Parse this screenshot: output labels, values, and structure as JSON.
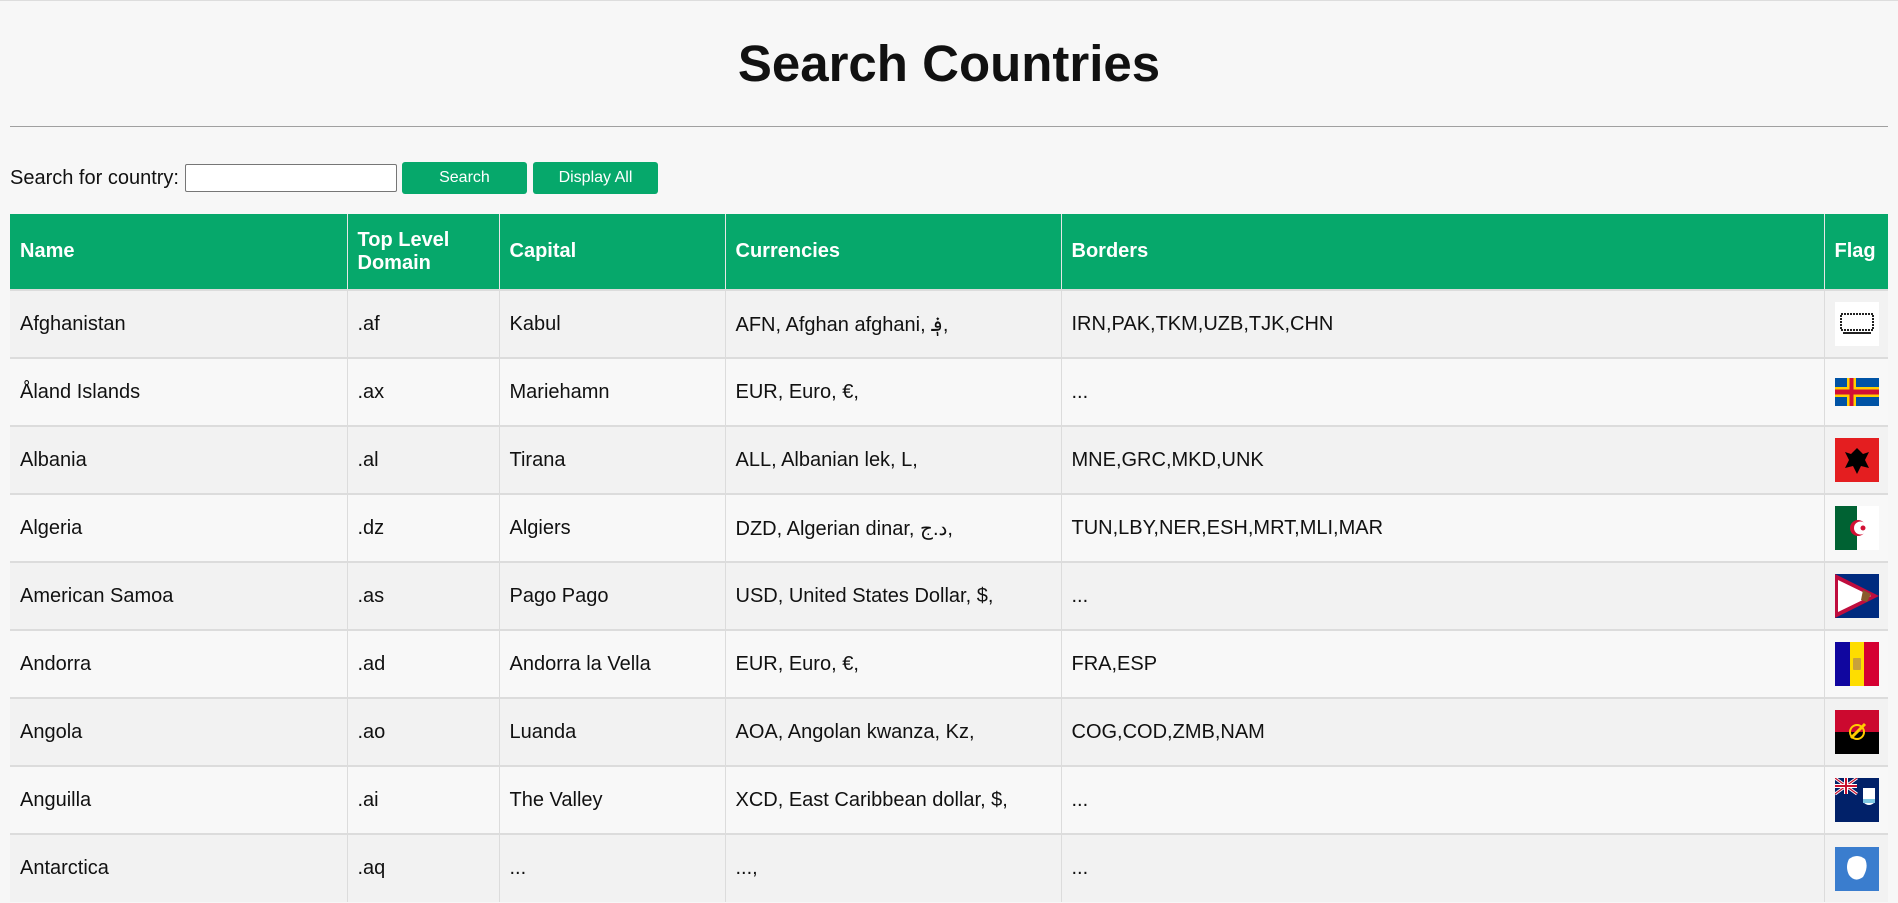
{
  "page": {
    "title": "Search Countries"
  },
  "search": {
    "label": "Search for country:",
    "value": "",
    "placeholder": "",
    "search_button": "Search",
    "display_all_button": "Display All"
  },
  "table": {
    "headers": {
      "name": "Name",
      "tld": "Top Level Domain",
      "capital": "Capital",
      "currencies": "Currencies",
      "borders": "Borders",
      "flag": "Flag"
    },
    "rows": [
      {
        "name": "Afghanistan",
        "tld": ".af",
        "capital": "Kabul",
        "currencies": "AFN, Afghan afghani, ؋,",
        "borders": "IRN,PAK,TKM,UZB,TJK,CHN",
        "flag": "afghanistan-flag"
      },
      {
        "name": "Åland Islands",
        "tld": ".ax",
        "capital": "Mariehamn",
        "currencies": "EUR, Euro, €,",
        "borders": "...",
        "flag": "aland-islands-flag"
      },
      {
        "name": "Albania",
        "tld": ".al",
        "capital": "Tirana",
        "currencies": "ALL, Albanian lek, L,",
        "borders": "MNE,GRC,MKD,UNK",
        "flag": "albania-flag"
      },
      {
        "name": "Algeria",
        "tld": ".dz",
        "capital": "Algiers",
        "currencies": "DZD, Algerian dinar, د.ج,",
        "borders": "TUN,LBY,NER,ESH,MRT,MLI,MAR",
        "flag": "algeria-flag"
      },
      {
        "name": "American Samoa",
        "tld": ".as",
        "capital": "Pago Pago",
        "currencies": "USD, United States Dollar, $,",
        "borders": "...",
        "flag": "american-samoa-flag"
      },
      {
        "name": "Andorra",
        "tld": ".ad",
        "capital": "Andorra la Vella",
        "currencies": "EUR, Euro, €,",
        "borders": "FRA,ESP",
        "flag": "andorra-flag"
      },
      {
        "name": "Angola",
        "tld": ".ao",
        "capital": "Luanda",
        "currencies": "AOA, Angolan kwanza, Kz,",
        "borders": "COG,COD,ZMB,NAM",
        "flag": "angola-flag"
      },
      {
        "name": "Anguilla",
        "tld": ".ai",
        "capital": "The Valley",
        "currencies": "XCD, East Caribbean dollar, $,",
        "borders": "...",
        "flag": "anguilla-flag"
      },
      {
        "name": "Antarctica",
        "tld": ".aq",
        "capital": "...",
        "currencies": "...,",
        "borders": "...",
        "flag": "antarctica-flag"
      }
    ]
  }
}
